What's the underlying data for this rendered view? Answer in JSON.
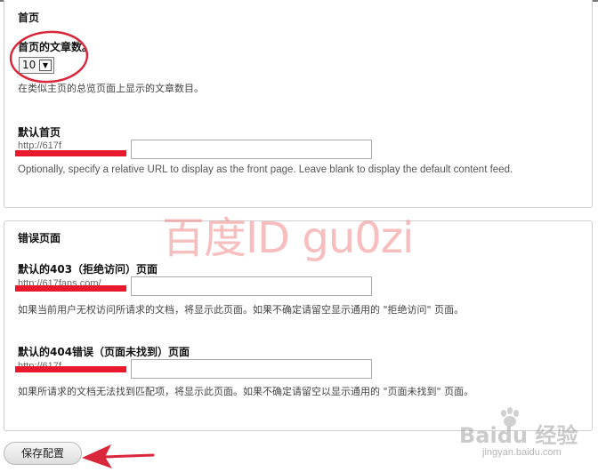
{
  "homepage": {
    "legend": "首页",
    "count_label": "首页的文章数。",
    "count_value": "10",
    "count_desc": "在类似主页的总览页面上显示的文章数目。",
    "default_front_label": "默认首页",
    "default_front_prefix": "http://617f",
    "default_front_value": "",
    "default_front_desc": "Optionally, specify a relative URL to display as the front page. Leave blank to display the default content feed."
  },
  "errors": {
    "legend": "错误页面",
    "page403_label": "默认的403（拒绝访问）页面",
    "page403_prefix": "http://617fans.com/",
    "page403_value": "",
    "page403_desc": "如果当前用户无权访问所请求的文档，将显示此页面。如果不确定请留空显示通用的 \"拒绝访问\" 页面。",
    "page404_label": "默认的404错误（页面未找到）页面",
    "page404_prefix": "http://617f",
    "page404_value": "",
    "page404_desc": "如果所请求的文档无法找到匹配项，将显示此页面。如果不确定请留空以显示通用的 \"页面未找到\" 页面。"
  },
  "actions": {
    "save_label": "保存配置"
  },
  "overlays": {
    "watermark": "百度ID gu0zi",
    "baidu_logo": "Baidu 经验",
    "baidu_url": "jingyan.baidu.com",
    "annotation_color": "#d9263a",
    "redaction_color": "#e8192c"
  }
}
